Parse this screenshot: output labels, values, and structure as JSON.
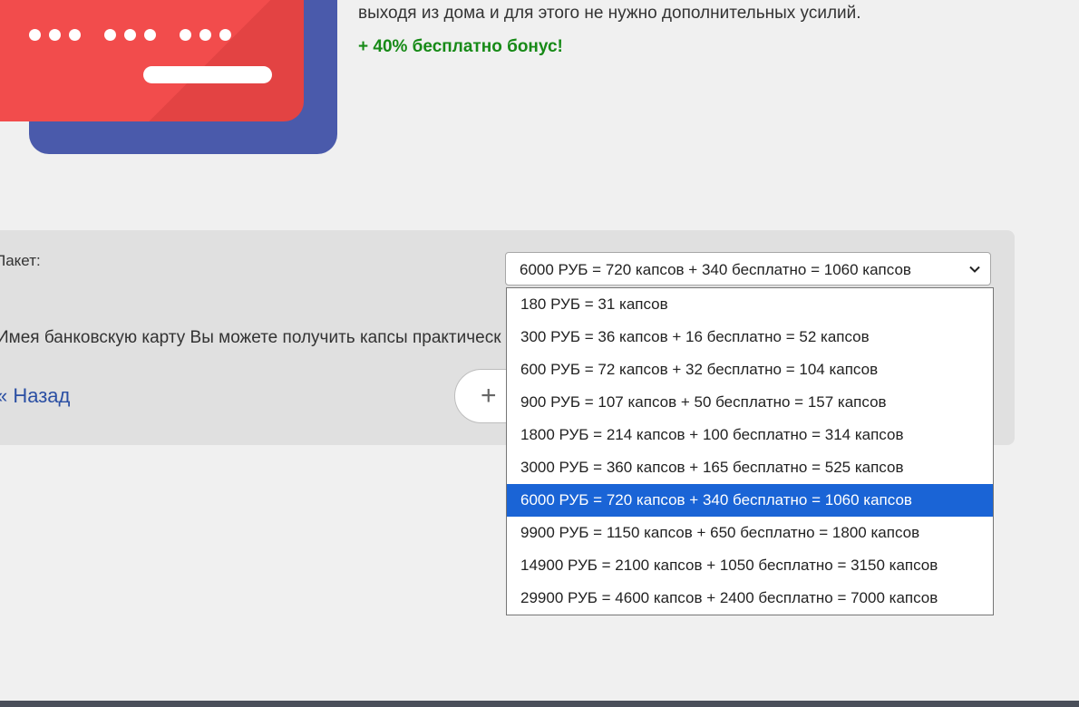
{
  "description": {
    "line": "выходя из дома и для этого не нужно дополнительных усилий.",
    "bonus": "+ 40% бесплатно бонус!"
  },
  "form": {
    "packet_label": "Пакет:",
    "selected_value": "6000 РУБ = 720 капсов + 340 бесплатно = 1060 капсов",
    "info_text": "Имея банковскую карту Вы можете получить капсы практическ",
    "back_link": "« Назад",
    "plus_symbol": "+"
  },
  "dropdown": {
    "options": [
      "180 РУБ = 31 капсов",
      "300 РУБ = 36 капсов + 16 бесплатно = 52 капсов",
      "600 РУБ = 72 капсов + 32 бесплатно = 104 капсов",
      "900 РУБ = 107 капсов + 50 бесплатно = 157 капсов",
      "1800 РУБ = 214 капсов + 100 бесплатно = 314 капсов",
      "3000 РУБ = 360 капсов + 165 бесплатно = 525 капсов",
      "6000 РУБ = 720 капсов + 340 бесплатно = 1060 капсов",
      "9900 РУБ = 1150 капсов + 650 бесплатно = 1800 капсов",
      "14900 РУБ = 2100 капсов + 1050 бесплатно = 3150 капсов",
      "29900 РУБ = 4600 капсов + 2400 бесплатно = 7000 капсов"
    ],
    "selected_index": 6
  },
  "icons": {
    "caret": "chevron-down-icon",
    "illustration": "credit-card-illustration"
  },
  "colors": {
    "bonus": "#178a17",
    "link": "#2b4fa3",
    "highlight": "#1a64d6",
    "card_front": "#f24c4c",
    "card_back": "#4a5aab"
  }
}
